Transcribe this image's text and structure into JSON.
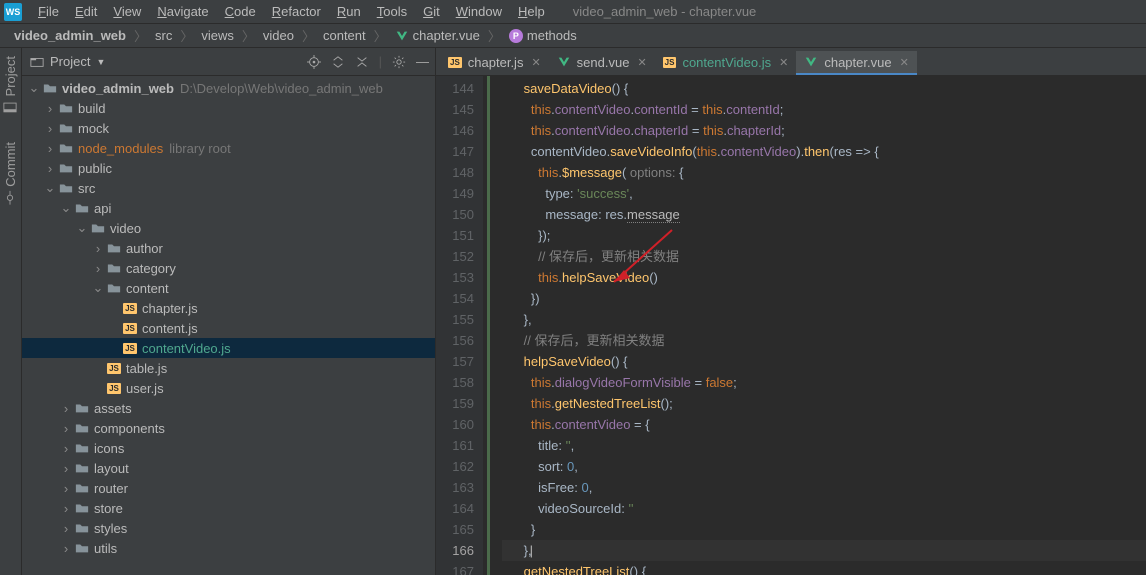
{
  "window_title": "video_admin_web - chapter.vue",
  "menu": [
    "File",
    "Edit",
    "View",
    "Navigate",
    "Code",
    "Refactor",
    "Run",
    "Tools",
    "Git",
    "Window",
    "Help"
  ],
  "breadcrumbs": [
    {
      "label": "video_admin_web",
      "icon": "none"
    },
    {
      "label": "src",
      "icon": "none"
    },
    {
      "label": "views",
      "icon": "none"
    },
    {
      "label": "video",
      "icon": "none"
    },
    {
      "label": "content",
      "icon": "none"
    },
    {
      "label": "chapter.vue",
      "icon": "vue"
    },
    {
      "label": "methods",
      "icon": "method"
    }
  ],
  "left_rails": [
    {
      "label": "Project",
      "icon": "project"
    },
    {
      "label": "Commit",
      "icon": "commit"
    }
  ],
  "project_panel": {
    "title": "Project",
    "root": {
      "label": "video_admin_web",
      "suffix": "D:\\Develop\\Web\\video_admin_web"
    },
    "tree": [
      {
        "d": 1,
        "t": "f",
        "o": true,
        "l": "video_admin_web",
        "suf": "D:\\Develop\\Web\\video_admin_web",
        "bold": true
      },
      {
        "d": 2,
        "t": "f",
        "o": false,
        "l": "build"
      },
      {
        "d": 2,
        "t": "f",
        "o": false,
        "l": "mock"
      },
      {
        "d": 2,
        "t": "f",
        "o": false,
        "l": "node_modules",
        "suf": "library root",
        "orange": true
      },
      {
        "d": 2,
        "t": "f",
        "o": false,
        "l": "public"
      },
      {
        "d": 2,
        "t": "f",
        "o": true,
        "l": "src"
      },
      {
        "d": 3,
        "t": "f",
        "o": true,
        "l": "api"
      },
      {
        "d": 4,
        "t": "f",
        "o": true,
        "l": "video"
      },
      {
        "d": 5,
        "t": "f",
        "o": false,
        "l": "author"
      },
      {
        "d": 5,
        "t": "f",
        "o": false,
        "l": "category"
      },
      {
        "d": 5,
        "t": "f",
        "o": true,
        "l": "content"
      },
      {
        "d": 6,
        "t": "js",
        "l": "chapter.js"
      },
      {
        "d": 6,
        "t": "js",
        "l": "content.js"
      },
      {
        "d": 6,
        "t": "js",
        "l": "contentVideo.js",
        "sel": true,
        "teal": true
      },
      {
        "d": 5,
        "t": "js",
        "l": "table.js"
      },
      {
        "d": 5,
        "t": "js",
        "l": "user.js"
      },
      {
        "d": 3,
        "t": "f",
        "o": false,
        "l": "assets"
      },
      {
        "d": 3,
        "t": "f",
        "o": false,
        "l": "components"
      },
      {
        "d": 3,
        "t": "f",
        "o": false,
        "l": "icons"
      },
      {
        "d": 3,
        "t": "f",
        "o": false,
        "l": "layout"
      },
      {
        "d": 3,
        "t": "f",
        "o": false,
        "l": "router"
      },
      {
        "d": 3,
        "t": "f",
        "o": false,
        "l": "store"
      },
      {
        "d": 3,
        "t": "f",
        "o": false,
        "l": "styles"
      },
      {
        "d": 3,
        "t": "f",
        "o": false,
        "l": "utils"
      }
    ]
  },
  "editor_tabs": [
    {
      "label": "chapter.js",
      "icon": "js"
    },
    {
      "label": "send.vue",
      "icon": "vue"
    },
    {
      "label": "contentVideo.js",
      "icon": "js",
      "teal": true
    },
    {
      "label": "chapter.vue",
      "icon": "vue",
      "active": true
    }
  ],
  "line_start": 144,
  "line_end": 167,
  "current_line": 166,
  "code_lines": [
    "<span class='fn'>saveDataVideo</span>() {",
    "  <span class='kw'>this</span>.<span class='pr'>contentVideo</span>.<span class='pr'>contentId</span> = <span class='kw'>this</span>.<span class='pr'>contentId</span>;",
    "  <span class='kw'>this</span>.<span class='pr'>contentVideo</span>.<span class='pr'>chapterId</span> = <span class='kw'>this</span>.<span class='pr'>chapterId</span>;",
    "  <span class='id'>contentVideo</span>.<span class='fn'>saveVideoInfo</span>(<span class='kw'>this</span>.<span class='pr'>contentVideo</span>).<span class='fn'>then</span>(<span class='id'>res</span> => {",
    "    <span class='kw'>this</span>.<span class='fn'>$message</span>( <span class='cm'>options:</span> {",
    "      <span class='id'>type</span>: <span class='st'>'success'</span>,",
    "      <span class='id'>message</span>: <span class='id'>res</span>.<span class='wv'>message</span>",
    "    });",
    "    <span class='cm'>// 保存后，更新相关数据</span>",
    "    <span class='kw'>this</span>.<span class='fn'>helpSaveVideo</span>()",
    "  })",
    "},",
    "<span class='cm'>// 保存后，更新相关数据</span>",
    "<span class='fn'>helpSaveVideo</span>() {",
    "  <span class='kw'>this</span>.<span class='pr'>dialogVideoFormVisible</span> = <span class='kw'>false</span>;",
    "  <span class='kw'>this</span>.<span class='fn'>getNestedTreeList</span>();",
    "  <span class='kw'>this</span>.<span class='pr'>contentVideo</span> = {",
    "    <span class='id'>title</span>: <span class='st'>''</span>,",
    "    <span class='id'>sort</span>: <span class='nm'>0</span>,",
    "    <span class='id'>isFree</span>: <span class='nm'>0</span>,",
    "    <span class='id'>videoSourceId</span>: <span class='st'>''</span>",
    "  }",
    "},<span class='caret'></span>",
    "<span class='fn'>getNestedTreeList</span>() {"
  ]
}
